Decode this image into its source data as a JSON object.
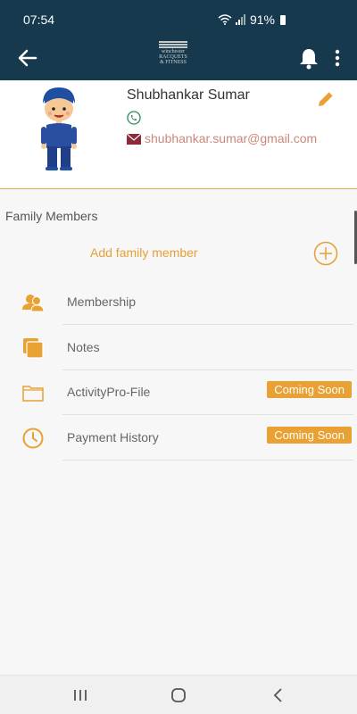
{
  "status": {
    "time": "07:54",
    "battery": "91%"
  },
  "header": {
    "logo_text": [
      "winchester",
      "RACQUETS",
      "& FITNESS"
    ]
  },
  "profile": {
    "name": "Shubhankar Sumar",
    "email": "shubhankar.sumar@gmail.com"
  },
  "family": {
    "title": "Family Members",
    "add_label": "Add family member"
  },
  "menu": [
    {
      "label": "Membership",
      "badge": ""
    },
    {
      "label": "Notes",
      "badge": ""
    },
    {
      "label": "ActivityPro-File",
      "badge": "Coming Soon"
    },
    {
      "label": "Payment History",
      "badge": "Coming Soon"
    }
  ],
  "colors": {
    "header": "#16394d",
    "accent": "#e8a132",
    "phone": "#2f8a5a",
    "mail": "#8a2a3a"
  }
}
